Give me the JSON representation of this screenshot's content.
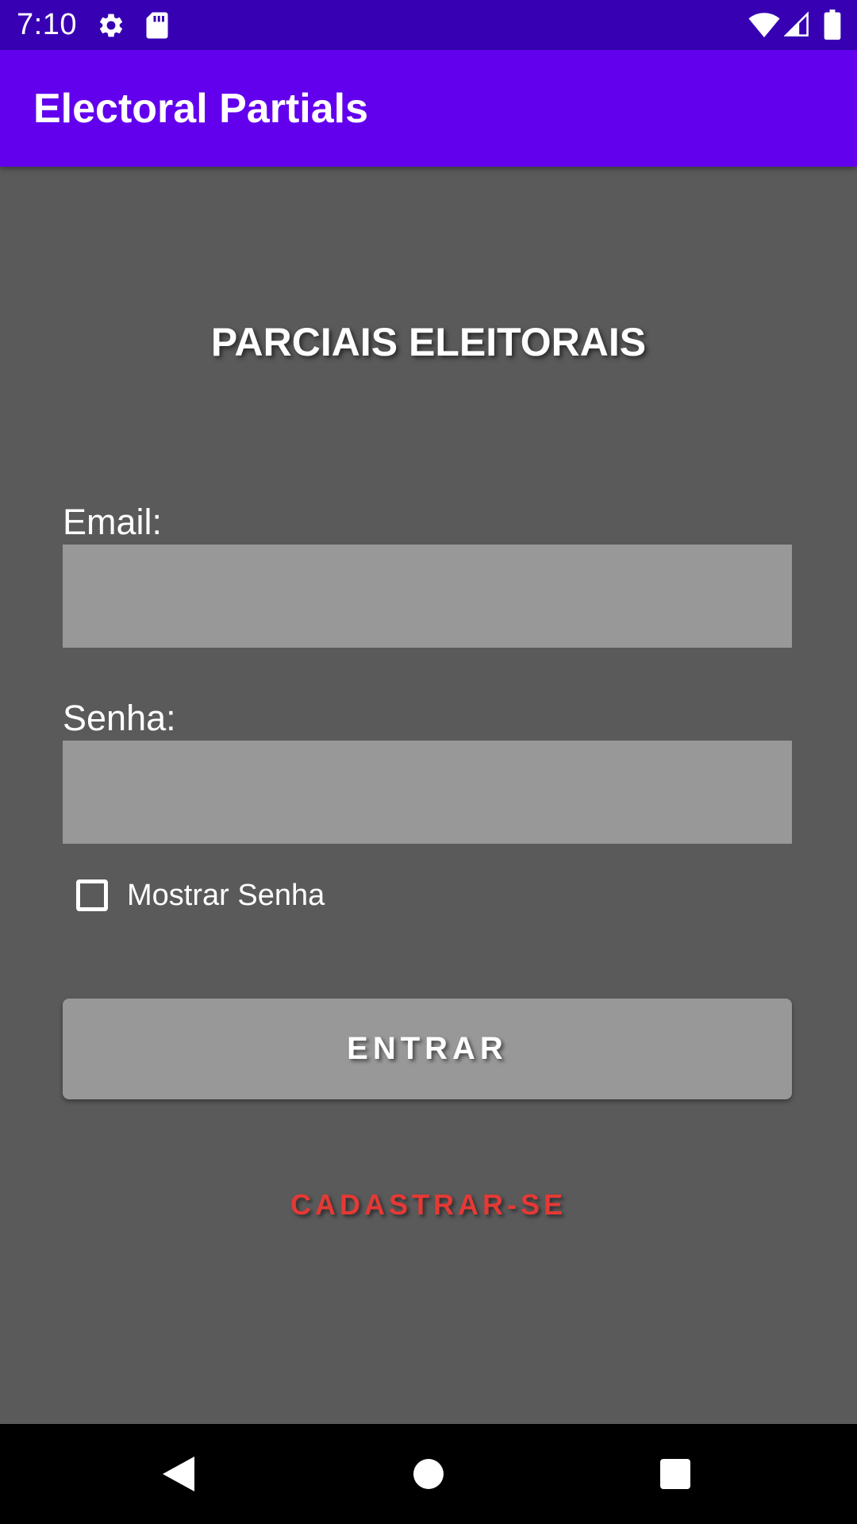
{
  "status_bar": {
    "time": "7:10",
    "icons": [
      "settings-icon",
      "sd-card-icon",
      "wifi-icon",
      "signal-icon",
      "battery-icon"
    ],
    "background": "#3700b3"
  },
  "app_bar": {
    "title": "Electoral Partials",
    "background": "#6200ee"
  },
  "login": {
    "heading": "PARCIAIS ELEITORAIS",
    "email_label": "Email:",
    "email_value": "",
    "password_label": "Senha:",
    "password_value": "",
    "show_password_label": "Mostrar Senha",
    "show_password_checked": false,
    "enter_button": "ENTRAR",
    "register_link": "CADASTRAR-SE",
    "register_color": "#e53935"
  },
  "nav_bar": {
    "buttons": [
      "back-icon",
      "home-icon",
      "recents-icon"
    ]
  }
}
